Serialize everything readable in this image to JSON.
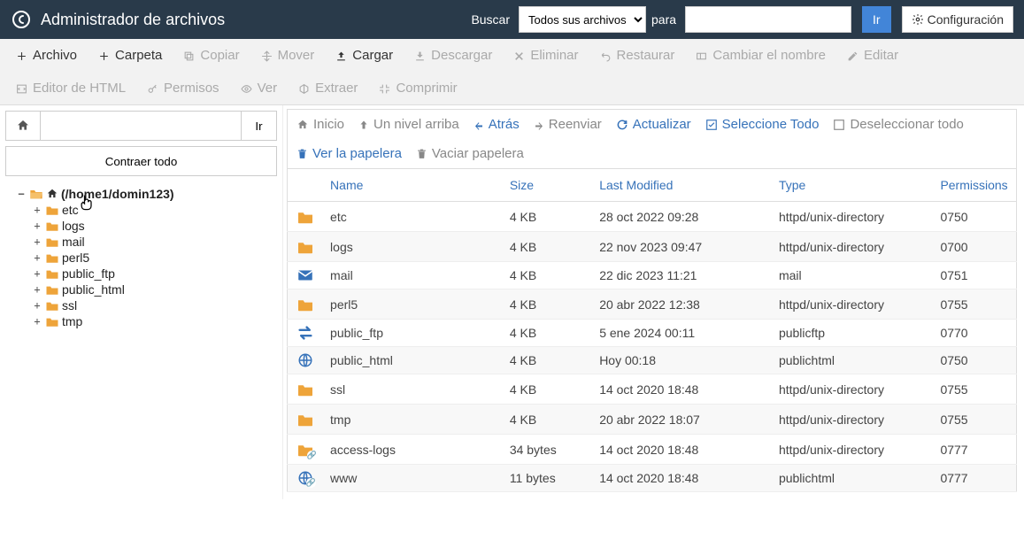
{
  "header": {
    "title": "Administrador de archivos",
    "search_label": "Buscar",
    "search_select": "Todos sus archivos",
    "para_label": "para",
    "go_label": "Ir",
    "config_label": "Configuración"
  },
  "toolbar": [
    {
      "label": "Archivo",
      "icon": "plus",
      "disabled": false
    },
    {
      "label": "Carpeta",
      "icon": "plus",
      "disabled": false
    },
    {
      "label": "Copiar",
      "icon": "copy",
      "disabled": true
    },
    {
      "label": "Mover",
      "icon": "move",
      "disabled": true
    },
    {
      "label": "Cargar",
      "icon": "upload",
      "disabled": false
    },
    {
      "label": "Descargar",
      "icon": "download",
      "disabled": true
    },
    {
      "label": "Eliminar",
      "icon": "x",
      "disabled": true
    },
    {
      "label": "Restaurar",
      "icon": "undo",
      "disabled": true
    },
    {
      "label": "Cambiar el nombre",
      "icon": "rename",
      "disabled": true
    },
    {
      "label": "Editar",
      "icon": "pencil",
      "disabled": true
    },
    {
      "label": "Editor de HTML",
      "icon": "html",
      "disabled": true
    },
    {
      "label": "Permisos",
      "icon": "key",
      "disabled": true
    },
    {
      "label": "Ver",
      "icon": "eye",
      "disabled": true
    },
    {
      "label": "Extraer",
      "icon": "extract",
      "disabled": true
    },
    {
      "label": "Comprimir",
      "icon": "compress",
      "disabled": true
    }
  ],
  "sidebar": {
    "go_label": "Ir",
    "collapse_label": "Contraer todo",
    "root_label": "(/home1/domin123)",
    "items": [
      {
        "label": "etc"
      },
      {
        "label": "logs"
      },
      {
        "label": "mail"
      },
      {
        "label": "perl5"
      },
      {
        "label": "public_ftp"
      },
      {
        "label": "public_html"
      },
      {
        "label": "ssl"
      },
      {
        "label": "tmp"
      }
    ]
  },
  "nav": [
    {
      "label": "Inicio",
      "icon": "home",
      "blue": false
    },
    {
      "label": "Un nivel arriba",
      "icon": "up",
      "blue": false
    },
    {
      "label": "Atrás",
      "icon": "left",
      "blue": true
    },
    {
      "label": "Reenviar",
      "icon": "right",
      "blue": false
    },
    {
      "label": "Actualizar",
      "icon": "refresh",
      "blue": true
    },
    {
      "label": "Seleccione Todo",
      "icon": "check",
      "blue": true
    },
    {
      "label": "Deseleccionar todo",
      "icon": "uncheck",
      "blue": false
    },
    {
      "label": "Ver la papelera",
      "icon": "trash",
      "blue": true
    },
    {
      "label": "Vaciar papelera",
      "icon": "trash",
      "blue": false
    }
  ],
  "table": {
    "headers": {
      "name": "Name",
      "size": "Size",
      "lastmod": "Last Modified",
      "type": "Type",
      "perm": "Permissions"
    },
    "rows": [
      {
        "icon": "folder",
        "name": "etc",
        "size": "4 KB",
        "lm": "28 oct 2022 09:28",
        "type": "httpd/unix-directory",
        "perm": "0750"
      },
      {
        "icon": "folder",
        "name": "logs",
        "size": "4 KB",
        "lm": "22 nov 2023 09:47",
        "type": "httpd/unix-directory",
        "perm": "0700"
      },
      {
        "icon": "mail",
        "name": "mail",
        "size": "4 KB",
        "lm": "22 dic 2023 11:21",
        "type": "mail",
        "perm": "0751"
      },
      {
        "icon": "folder",
        "name": "perl5",
        "size": "4 KB",
        "lm": "20 abr 2022 12:38",
        "type": "httpd/unix-directory",
        "perm": "0755"
      },
      {
        "icon": "transfer",
        "name": "public_ftp",
        "size": "4 KB",
        "lm": "5 ene 2024 00:11",
        "type": "publicftp",
        "perm": "0770"
      },
      {
        "icon": "globe",
        "name": "public_html",
        "size": "4 KB",
        "lm": "Hoy 00:18",
        "type": "publichtml",
        "perm": "0750"
      },
      {
        "icon": "folder",
        "name": "ssl",
        "size": "4 KB",
        "lm": "14 oct 2020 18:48",
        "type": "httpd/unix-directory",
        "perm": "0755"
      },
      {
        "icon": "folder",
        "name": "tmp",
        "size": "4 KB",
        "lm": "20 abr 2022 18:07",
        "type": "httpd/unix-directory",
        "perm": "0755"
      },
      {
        "icon": "folder-link",
        "name": "access-logs",
        "size": "34 bytes",
        "lm": "14 oct 2020 18:48",
        "type": "httpd/unix-directory",
        "perm": "0777"
      },
      {
        "icon": "globe-link",
        "name": "www",
        "size": "11 bytes",
        "lm": "14 oct 2020 18:48",
        "type": "publichtml",
        "perm": "0777"
      }
    ]
  }
}
